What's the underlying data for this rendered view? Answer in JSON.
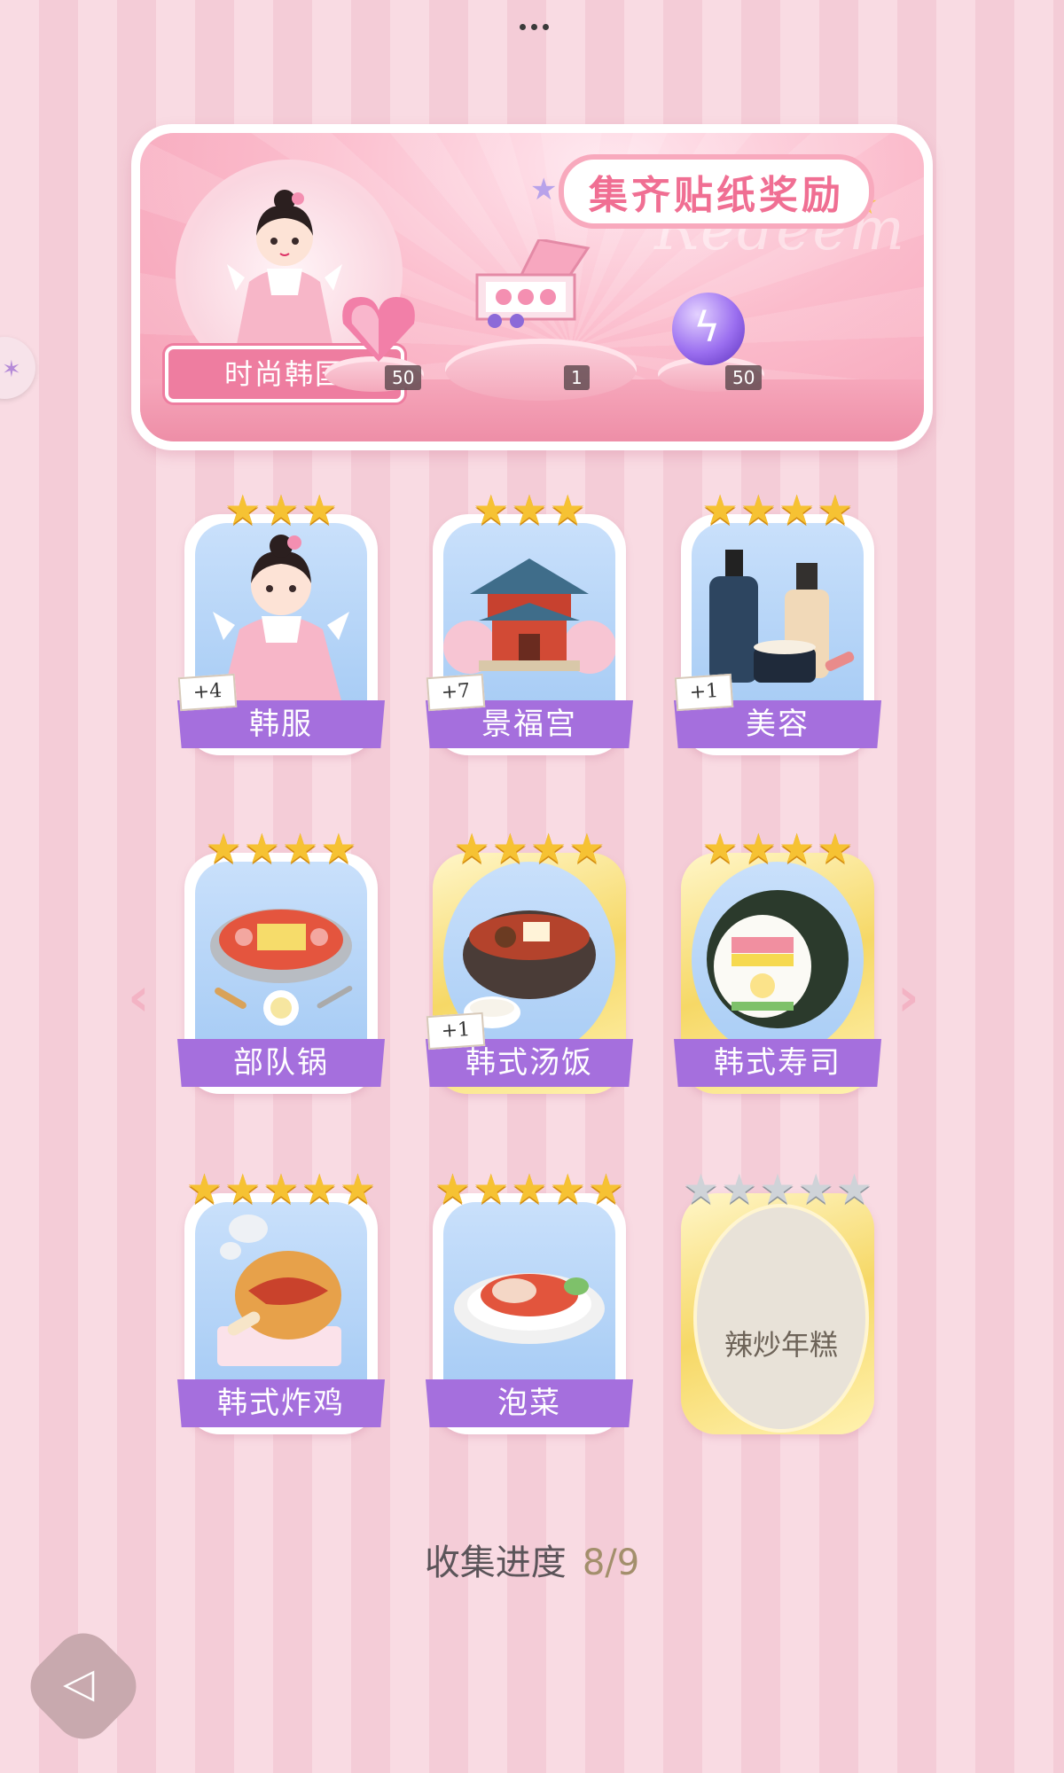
{
  "header": {
    "more_menu": "more-icon"
  },
  "reward": {
    "title": "集齐贴纸奖励",
    "watermark": "Redeem",
    "theme_label": "时尚韩国",
    "items": [
      {
        "icon": "heart-gem-icon",
        "count": "50"
      },
      {
        "icon": "gift-box-icon",
        "count": "1"
      },
      {
        "icon": "energy-orb-icon",
        "count": "50"
      }
    ]
  },
  "cards": [
    {
      "name": "韩服",
      "stars": 3,
      "bonus": "+4",
      "gold": false,
      "collected": true
    },
    {
      "name": "景福宫",
      "stars": 3,
      "bonus": "+7",
      "gold": false,
      "collected": true
    },
    {
      "name": "美容",
      "stars": 4,
      "bonus": "+1",
      "gold": false,
      "collected": true
    },
    {
      "name": "部队锅",
      "stars": 4,
      "bonus": "",
      "gold": false,
      "collected": true
    },
    {
      "name": "韩式汤饭",
      "stars": 4,
      "bonus": "+1",
      "gold": true,
      "collected": true
    },
    {
      "name": "韩式寿司",
      "stars": 4,
      "bonus": "",
      "gold": true,
      "collected": true
    },
    {
      "name": "韩式炸鸡",
      "stars": 5,
      "bonus": "",
      "gold": false,
      "collected": true
    },
    {
      "name": "泡菜",
      "stars": 5,
      "bonus": "",
      "gold": false,
      "collected": true
    },
    {
      "name": "辣炒年糕",
      "stars": 5,
      "bonus": "",
      "gold": true,
      "collected": false
    }
  ],
  "progress": {
    "label": "收集进度",
    "value": "8/9"
  },
  "colors": {
    "accent_purple": "#a56fdd",
    "pink": "#ee7da0",
    "star_gold": "#f6c233"
  }
}
